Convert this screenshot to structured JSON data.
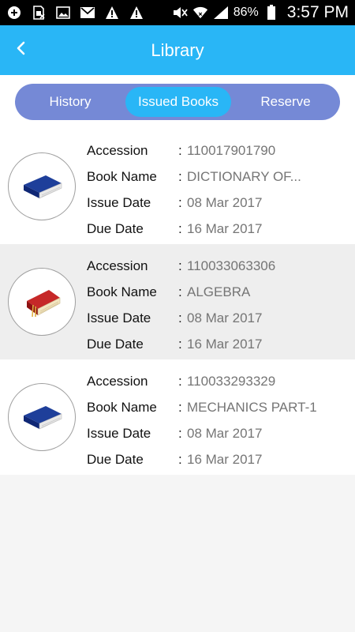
{
  "status_bar": {
    "battery_percent": "86%",
    "time": "3:57 PM",
    "left_icons": [
      "add-icon",
      "sim-icon",
      "image-icon",
      "mail-icon",
      "warning-icon",
      "warning-icon"
    ],
    "right_icons": [
      "mute-icon",
      "wifi-icon",
      "signal-icon",
      "battery-icon"
    ]
  },
  "header": {
    "title": "Library",
    "back_icon": "chevron-left-icon",
    "color": "#29b6f6"
  },
  "tabs": [
    {
      "label": "History",
      "active": false
    },
    {
      "label": "Issued Books",
      "active": true
    },
    {
      "label": "Reserve",
      "active": false
    }
  ],
  "labels": {
    "accession": "Accession",
    "book_name": "Book Name",
    "issue_date": "Issue Date",
    "due_date": "Due Date",
    "separator": ":"
  },
  "books": [
    {
      "accession": "110017901790",
      "book_name": "DICTIONARY OF...",
      "issue_date": "08 Mar 2017",
      "due_date": "16 Mar 2017",
      "icon": "blue-book-icon"
    },
    {
      "accession": "110033063306",
      "book_name": "ALGEBRA",
      "issue_date": "08 Mar 2017",
      "due_date": "16 Mar 2017",
      "icon": "red-book-icon"
    },
    {
      "accession": "110033293329",
      "book_name": "MECHANICS PART-1",
      "issue_date": "08 Mar 2017",
      "due_date": "16 Mar 2017",
      "icon": "blue-book-icon"
    }
  ]
}
